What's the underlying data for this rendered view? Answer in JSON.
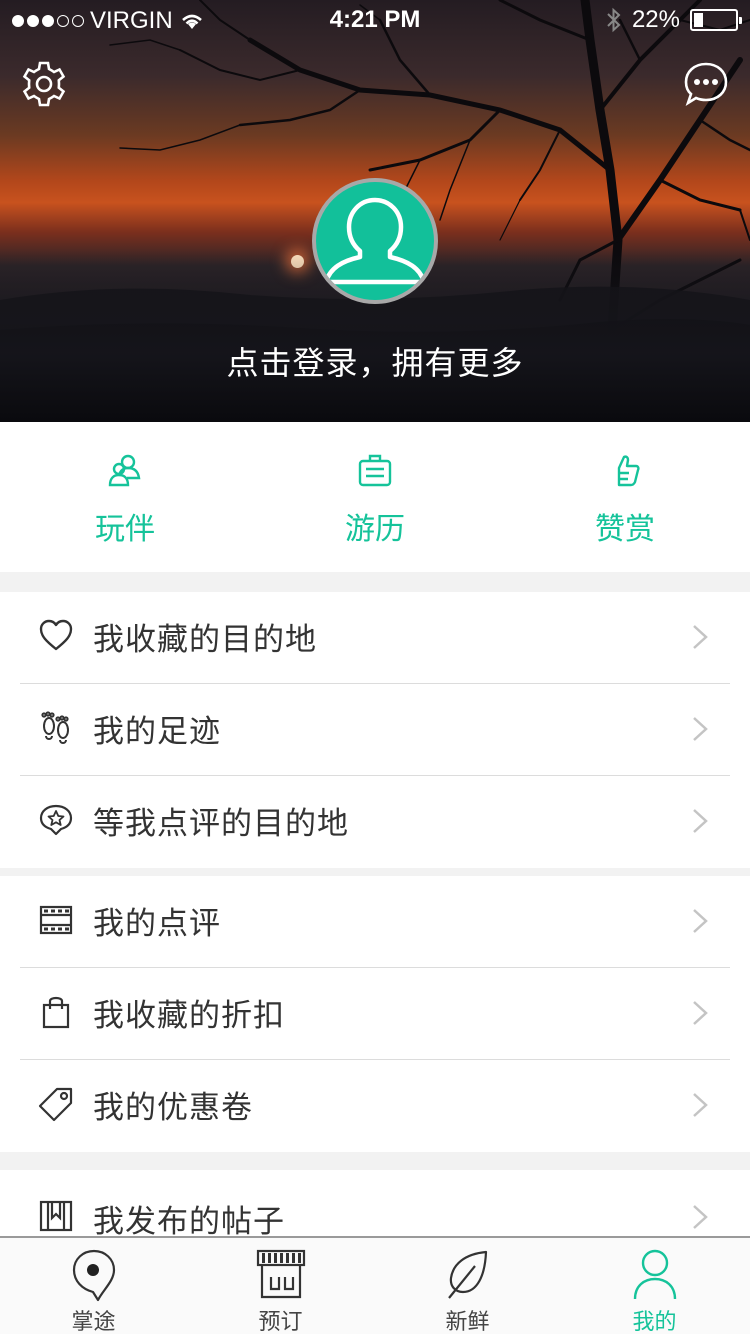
{
  "status_bar": {
    "carrier": "VIRGIN",
    "time": "4:21 PM",
    "battery": "22%",
    "battery_level": 0.22
  },
  "header": {
    "login_prompt": "点击登录，拥有更多",
    "settings_icon": "gear-icon",
    "message_icon": "chat-bubble-icon"
  },
  "quick_actions": [
    {
      "label": "玩伴",
      "icon": "companions-icon"
    },
    {
      "label": "游历",
      "icon": "suitcase-icon"
    },
    {
      "label": "赞赏",
      "icon": "thumbs-up-icon"
    }
  ],
  "menu": {
    "group1": [
      {
        "label": "我收藏的目的地",
        "icon": "heart-icon"
      },
      {
        "label": "我的足迹",
        "icon": "footprints-icon"
      },
      {
        "label": "等我点评的目的地",
        "icon": "star-location-icon"
      }
    ],
    "group2": [
      {
        "label": "我的点评",
        "icon": "film-strip-icon"
      },
      {
        "label": "我收藏的折扣",
        "icon": "shopping-bag-icon"
      },
      {
        "label": "我的优惠卷",
        "icon": "tag-icon"
      }
    ],
    "group3": [
      {
        "label": "我发布的帖子",
        "icon": "bookmark-frame-icon"
      }
    ]
  },
  "tabbar": [
    {
      "label": "掌途",
      "icon": "map-pin-icon",
      "active": false
    },
    {
      "label": "预订",
      "icon": "storefront-icon",
      "active": false
    },
    {
      "label": "新鲜",
      "icon": "leaf-icon",
      "active": false
    },
    {
      "label": "我的",
      "icon": "person-icon",
      "active": true
    }
  ],
  "colors": {
    "accent": "#15c39a",
    "avatar_bg": "#12c09a",
    "text": "#333333",
    "divider": "#dcdcdc"
  }
}
